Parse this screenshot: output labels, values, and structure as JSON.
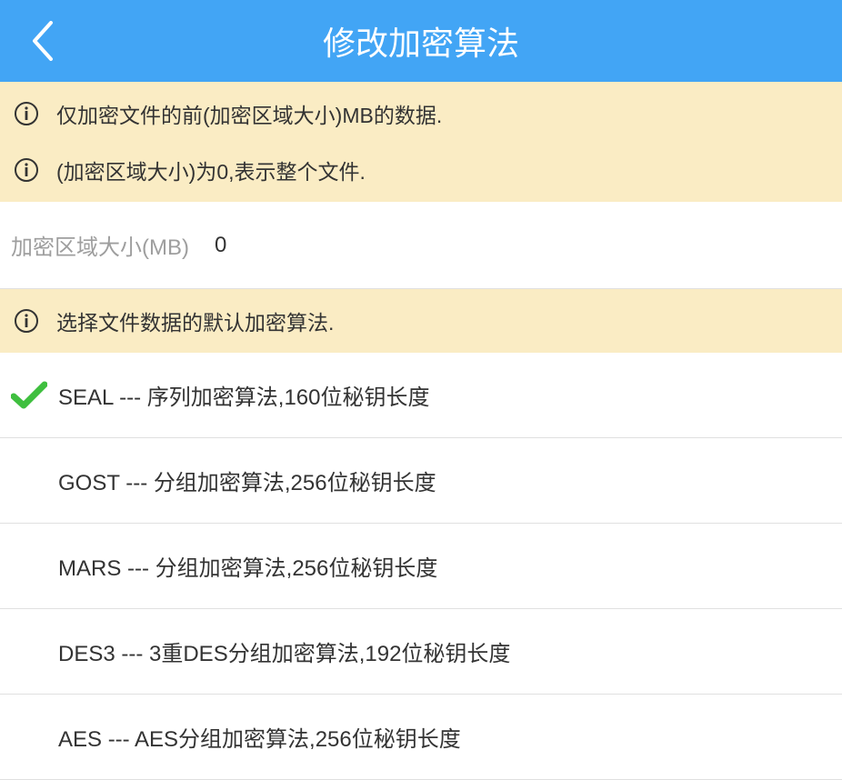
{
  "header": {
    "title": "修改加密算法"
  },
  "info1": {
    "line1": "仅加密文件的前(加密区域大小)MB的数据.",
    "line2": "(加密区域大小)为0,表示整个文件."
  },
  "field": {
    "label": "加密区域大小(MB)",
    "value": "0"
  },
  "info2": {
    "line1": "选择文件数据的默认加密算法."
  },
  "algorithms": [
    {
      "selected": true,
      "label": "SEAL --- 序列加密算法,160位秘钥长度"
    },
    {
      "selected": false,
      "label": "GOST --- 分组加密算法,256位秘钥长度"
    },
    {
      "selected": false,
      "label": "MARS --- 分组加密算法,256位秘钥长度"
    },
    {
      "selected": false,
      "label": "DES3 --- 3重DES分组加密算法,192位秘钥长度"
    },
    {
      "selected": false,
      "label": "AES --- AES分组加密算法,256位秘钥长度"
    }
  ],
  "colors": {
    "headerBg": "#42a5f5",
    "infoBg": "#faecc4",
    "check": "#3fbf3f",
    "muted": "#9e9e9e"
  }
}
